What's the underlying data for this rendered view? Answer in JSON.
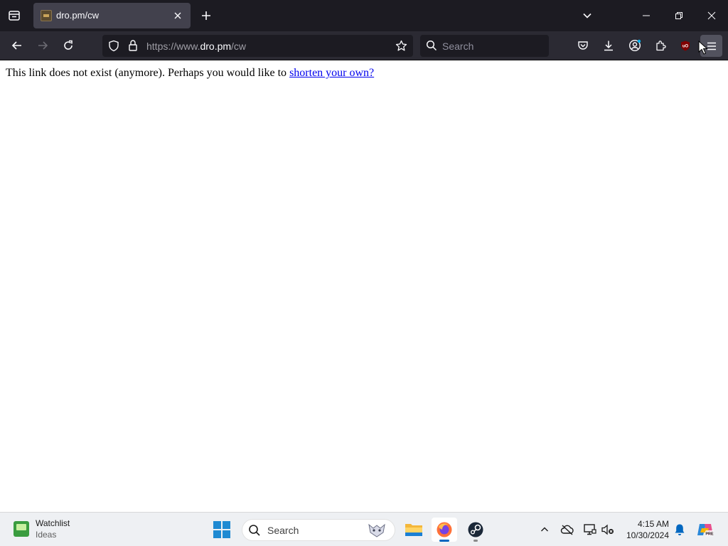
{
  "browser": {
    "tab": {
      "title": "dro.pm/cw",
      "favicon": "site-favicon"
    },
    "url": {
      "prefix": "https://www.",
      "host": "dro.pm",
      "path": "/cw"
    },
    "search_placeholder": "Search",
    "menu_icon": "hamburger-menu-icon"
  },
  "page": {
    "message": "This link does not exist (anymore). Perhaps you would like to ",
    "link_text": "shorten your own?",
    "link_color": "#0000ee"
  },
  "taskbar": {
    "widget": {
      "title": "Watchlist",
      "subtitle": "Ideas"
    },
    "search_placeholder": "Search",
    "apps": [
      "file-explorer-icon",
      "firefox-icon",
      "steam-icon"
    ],
    "clock": {
      "time": "4:15 AM",
      "date": "10/30/2024"
    }
  },
  "colors": {
    "chrome_dark": "#1c1b22",
    "chrome_toolbar": "#2b2a33",
    "tab_active": "#42414d",
    "taskbar_bg": "#eef0f3",
    "accent": "#0067c0"
  }
}
